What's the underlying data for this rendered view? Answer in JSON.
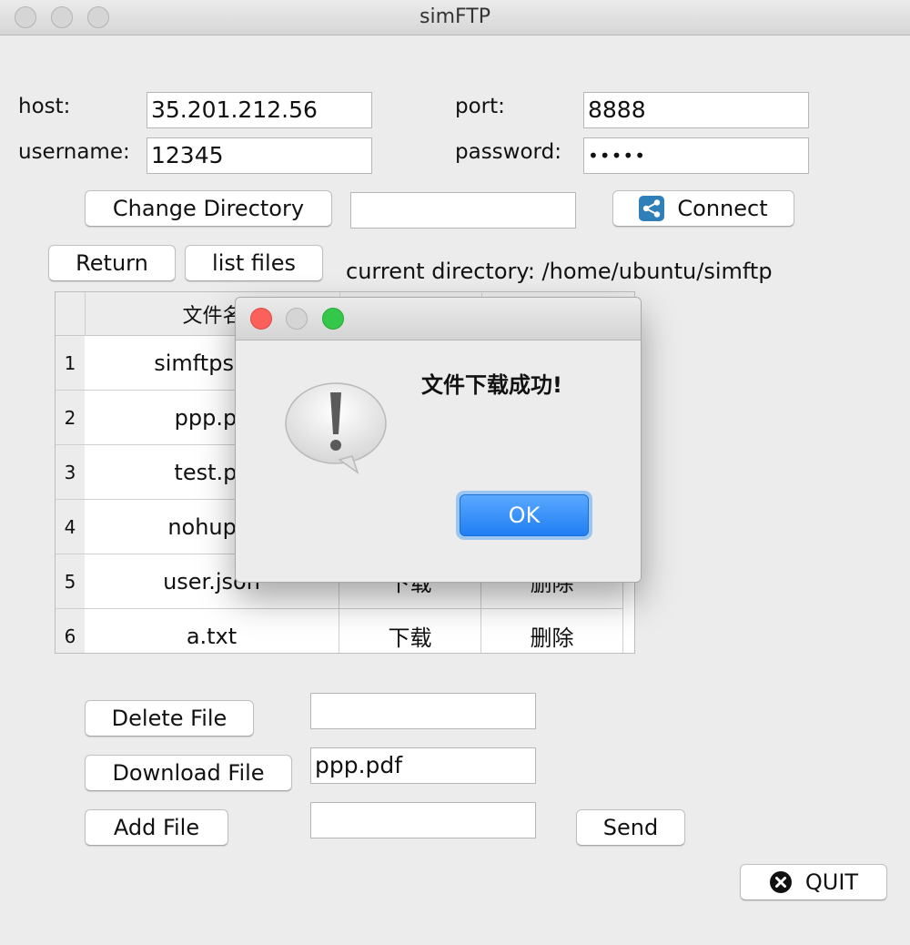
{
  "window": {
    "title": "simFTP"
  },
  "form": {
    "host_label": "host:",
    "host_value": "35.201.212.56",
    "port_label": "port:",
    "port_value": "8888",
    "username_label": "username:",
    "username_value": "12345",
    "password_label": "password:",
    "password_value": "•••••",
    "change_directory_button": "Change Directory",
    "directory_input_value": "",
    "connect_button": "Connect",
    "return_button": "Return",
    "list_files_button": "list files",
    "current_directory_label": "current directory: /home/ubuntu/simftp"
  },
  "table": {
    "header_visible": "文件名",
    "rows": [
      {
        "num": "1",
        "name": "simftpserv",
        "action1": "",
        "action2": ""
      },
      {
        "num": "2",
        "name": "ppp.pc",
        "action1": "",
        "action2": ""
      },
      {
        "num": "3",
        "name": "test.pc",
        "action1": "",
        "action2": ""
      },
      {
        "num": "4",
        "name": "nohup.c",
        "action1": "",
        "action2": ""
      },
      {
        "num": "5",
        "name": "user.json",
        "action1": "下载",
        "action2": "删除"
      },
      {
        "num": "6",
        "name": "a.txt",
        "action1": "下载",
        "action2": "删除"
      }
    ]
  },
  "file_ops": {
    "delete_button": "Delete File",
    "delete_input_value": "",
    "download_button": "Download File",
    "download_input_value": "ppp.pdf",
    "add_button": "Add File",
    "add_input_value": "",
    "send_button": "Send",
    "quit_button": "QUIT"
  },
  "dialog": {
    "message": "文件下载成功!",
    "ok_button": "OK"
  },
  "icons": {
    "connect": "share-icon",
    "quit": "close-circle-icon",
    "dialog": "warning-icon"
  },
  "colors": {
    "ok_button": "#1f7ff2",
    "close_light": "#fc605b",
    "zoom_light": "#34c84a"
  }
}
